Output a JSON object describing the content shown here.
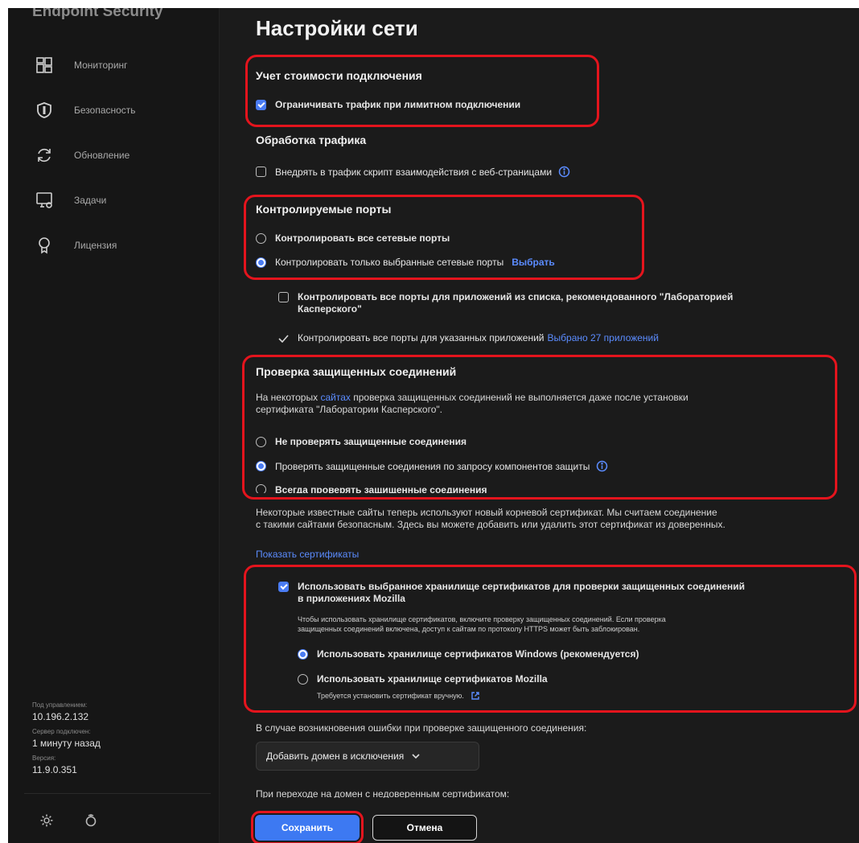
{
  "app": {
    "product_title": "Endpoint Security"
  },
  "sidebar": {
    "items": [
      {
        "label": "Мониторинг",
        "icon": "monitoring-icon"
      },
      {
        "label": "Безопасность",
        "icon": "shield-icon"
      },
      {
        "label": "Обновление",
        "icon": "update-icon"
      },
      {
        "label": "Задачи",
        "icon": "tasks-icon"
      },
      {
        "label": "Лицензия",
        "icon": "license-icon"
      }
    ],
    "meta": {
      "managed_label": "Под управлением:",
      "managed_value": "10.196.2.132",
      "server_label": "Сервер подключен:",
      "server_value": "1 минуту назад",
      "version_label": "Версия:",
      "version_value": "11.9.0.351"
    },
    "bottom_icons": [
      "settings-icon",
      "support-icon"
    ]
  },
  "main": {
    "title": "Настройки сети",
    "metered": {
      "heading": "Учет стоимости подключения",
      "option": "Ограничивать трафик при лимитном подключении",
      "checked": true
    },
    "traffic": {
      "heading": "Обработка трафика",
      "option": "Внедрять в трафик скрипт взаимодействия с веб-страницами",
      "checked": false
    },
    "ports": {
      "heading": "Контролируемые порты",
      "opt_all": "Контролировать все сетевые порты",
      "opt_selected": "Контролировать только выбранные сетевые порты",
      "select_link": "Выбрать",
      "selected_option": "selected",
      "sub_recommended_1": "Контролировать все порты для приложений из списка, рекомендованного \"Лабораторией",
      "sub_recommended_2": "Касперского\"",
      "sub_specified": "Контролировать все порты для указанных приложений",
      "sub_specified_link": "Выбрано 27 приложений"
    },
    "secure": {
      "heading": "Проверка защищенных соединений",
      "desc_pre": "На некоторых",
      "desc_link": "сайтах",
      "desc_post": "проверка защищенных соединений не выполняется даже после установки",
      "desc_line2": "сертификата \"Лаборатории Касперского\".",
      "opt_none": "Не проверять защищенные соединения",
      "opt_on_request": "Проверять защищенные соединения по запросу компонентов защиты",
      "opt_always": "Всегда проверять защищенные соединения",
      "selected_option": "on_request"
    },
    "root_cert": {
      "line1": "Некоторые известные сайты теперь используют новый корневой сертификат. Мы считаем соединение",
      "line2": "с такими сайтами безопасным. Здесь вы можете добавить или удалить этот сертификат из доверенных.",
      "show_link": "Показать сертификаты"
    },
    "mozilla": {
      "option_line1": "Использовать выбранное хранилище сертификатов для проверки защищенных соединений",
      "option_line2": "в приложениях Mozilla",
      "checked": true,
      "note_line1": "Чтобы использовать хранилище сертификатов, включите проверку защищенных соединений. Если проверка",
      "note_line2": "защищенных соединений включена, доступ к сайтам по протоколу HTTPS может быть заблокирован.",
      "opt_windows": "Использовать хранилище сертификатов Windows (рекомендуется)",
      "opt_mozilla": "Использовать хранилище сертификатов Mozilla",
      "opt_mozilla_note": "Требуется установить сертификат вручную.",
      "selected_option": "windows"
    },
    "error": {
      "label": "В случае возникновения ошибки при проверке защищенного соединения:",
      "dropdown_value": "Добавить домен в исключения"
    },
    "untrusted": {
      "label": "При переходе на домен с недоверенным сертификатом:"
    },
    "footer": {
      "save_label": "Сохранить",
      "cancel_label": "Отмена"
    }
  },
  "colors": {
    "accent": "#4a7cf3",
    "highlight": "#e4141d",
    "link": "#5b8cff",
    "background": "#1b1b1b"
  }
}
